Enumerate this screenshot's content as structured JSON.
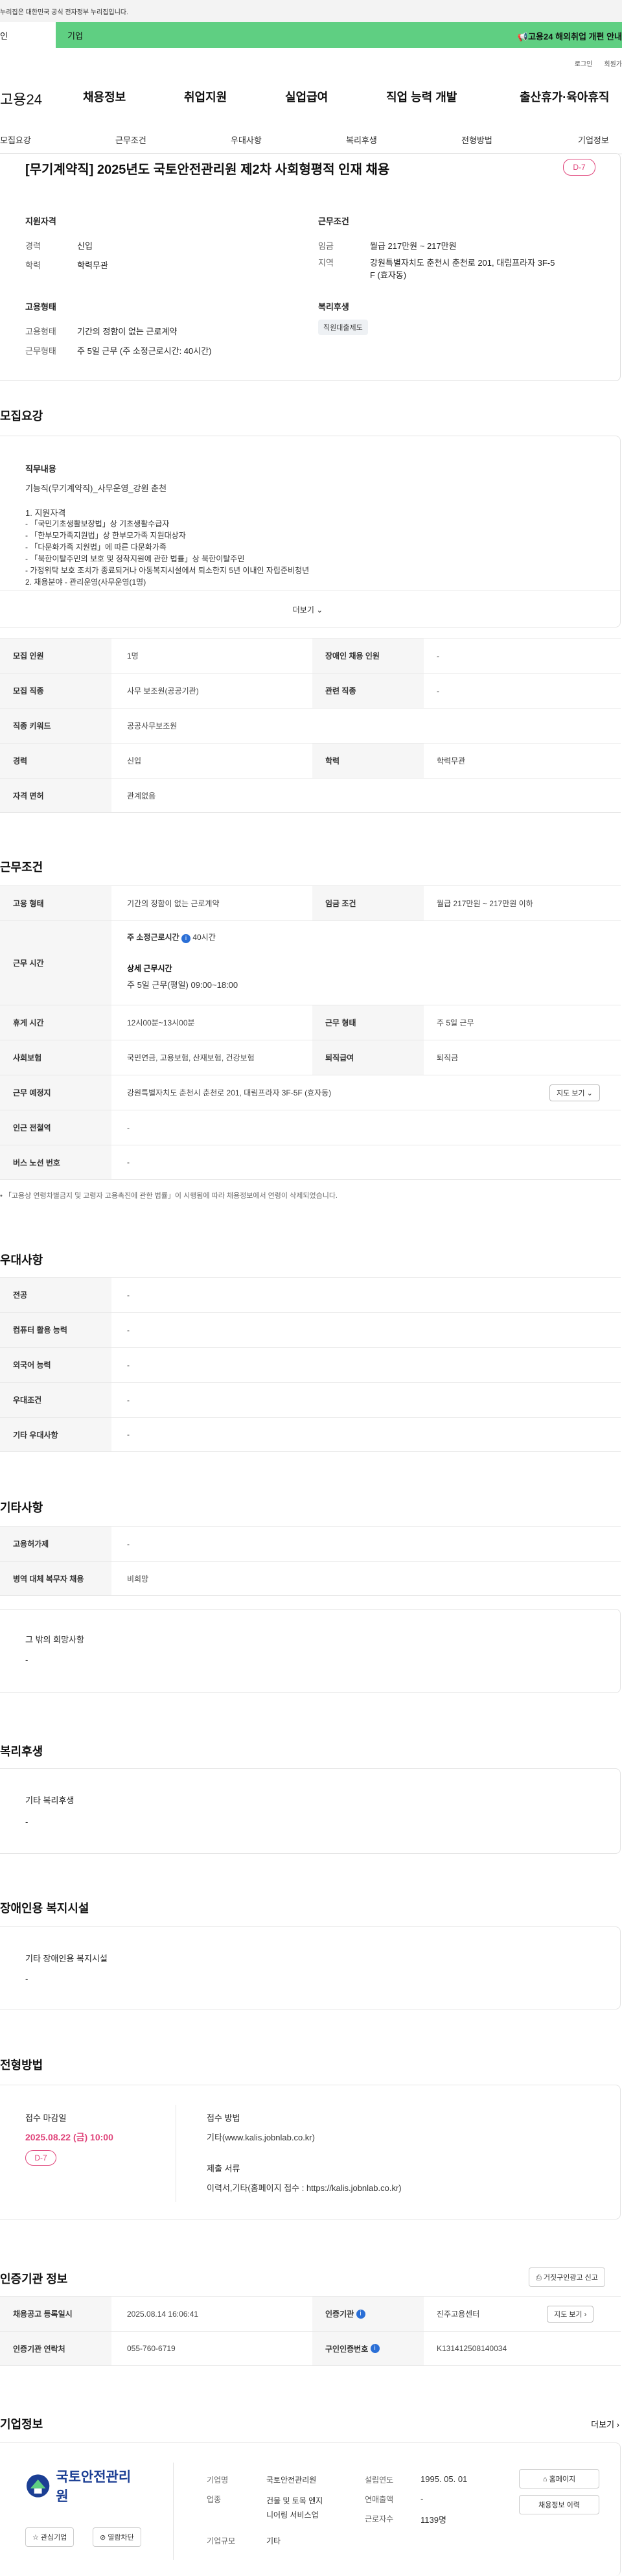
{
  "gov_notice": "누리집은 대한민국 공식 전자정부 누리집입니다.",
  "category": {
    "left": "인",
    "main": "기업",
    "banner": "고용24 해외취업 개편 안내"
  },
  "util": [
    "로그인",
    "회원가"
  ],
  "gnb": {
    "logo": "고용24",
    "items": [
      "채용정보",
      "취업지원",
      "실업급여",
      "직업 능력 개발",
      "출산휴가·육아휴직"
    ]
  },
  "subnav": [
    "모집요강",
    "근무조건",
    "우대사항",
    "복리후생",
    "전형방법",
    "기업정보"
  ],
  "header_card": {
    "title": "[무기계약직] 2025년도 국토안전관리원 제2차 사회형평적 인재 채용",
    "dday": "D-7",
    "qual_heading": "지원자격",
    "career_label": "경력",
    "career_value": "신입",
    "edu_label": "학력",
    "edu_value": "학력무관",
    "work_heading": "근무조건",
    "wage_label": "임금",
    "wage_value": "월급 217만원 ~ 217만원",
    "region_label": "지역",
    "region_value_1": "강원특별자치도 춘천시 춘천로 201, 대림프라자 3F-5",
    "region_value_2": "F (효자동)",
    "emp_heading": "고용형태",
    "emp_type_label": "고용형태",
    "emp_type_value": "기간의 정함이 없는 근로계약",
    "work_form_label": "근무형태",
    "work_form_value": "주 5일 근무 (주 소정근로시간: 40시간)",
    "welfare_heading": "복리후생",
    "welfare_badge": "직원대출제도"
  },
  "recruit": {
    "title": "모집요강",
    "job_heading": "직무내용",
    "job_line1": "기능직(무기계약직)_사무운영_강원 춘천",
    "lines": [
      "1. 지원자격",
      "  - 「국민기초생활보장법」상 기초생활수급자",
      "  - 「한부모가족지원법」상 한부모가족 지원대상자",
      "  - 「다문화가족 지원법」에 따른 다문화가족",
      "  - 「북한이탈주민의 보호 및 정착지원에 관한 법률」상 북한이탈주민",
      "  - 가정위탁 보호 조치가 종료되거나 아동복지시설에서 퇴소한지 5년 이내인 자립준비청년",
      "2. 채용분야 - 관리운영(사무운영(1명)"
    ],
    "more": "더보기",
    "rows": [
      {
        "k1": "모집 인원",
        "v1": "1명",
        "k2": "장애인 채용 인원",
        "v2": "-"
      },
      {
        "k1": "모집 직종",
        "v1": "사무 보조원(공공기관)",
        "k2": "관련 직종",
        "v2": "-"
      },
      {
        "k1": "직종 키워드",
        "v1": "공공사무보조원",
        "k2": "",
        "v2": ""
      },
      {
        "k1": "경력",
        "v1": "신입",
        "k2": "학력",
        "v2": "학력무관"
      },
      {
        "k1": "자격 면허",
        "v1": "관계없음",
        "k2": "",
        "v2": ""
      }
    ]
  },
  "work": {
    "title": "근무조건",
    "emp_label": "고용 형태",
    "emp_value": "기간의 정함이 없는 근로계약",
    "wage_label": "임금 조건",
    "wage_value": "월급 217만원 ~ 217만원 이하",
    "hours_label": "근무 시간",
    "hours_main": "주 소정근로시간",
    "hours_num": "40시간",
    "hours_detail_h": "상세 근무시간",
    "hours_detail": "주 5일 근무(평일) 09:00~18:00",
    "rest_label": "휴게 시간",
    "rest_value": "12시00분~13시00분",
    "form_label": "근무 형태",
    "form_value": "주 5일 근무",
    "ins_label": "사회보험",
    "ins_value": "국민연금, 고용보험, 산재보험, 건강보험",
    "retire_label": "퇴직급여",
    "retire_value": "퇴직금",
    "place_label": "근무 예정지",
    "place_value": "강원특별자치도 춘천시 춘천로 201, 대림프라자 3F-5F (효자동)",
    "map_btn": "지도 보기",
    "subway_label": "인근 전철역",
    "subway_value": "-",
    "bus_label": "버스 노선 번호",
    "bus_value": "-",
    "note": "「고용상 연령차별금지 및 고령자 고용촉진에 관한 법률」이 시행됨에 따라 채용정보에서 연령이 삭제되었습니다."
  },
  "pref": {
    "title": "우대사항",
    "rows": [
      [
        "전공",
        "-"
      ],
      [
        "컴퓨터 활용 능력",
        "-"
      ],
      [
        "외국어 능력",
        "-"
      ],
      [
        "우대조건",
        "-"
      ],
      [
        "기타 우대사항",
        "-"
      ]
    ]
  },
  "etc": {
    "title": "기타사항",
    "rows": [
      [
        "고용허가제",
        "-"
      ],
      [
        "병역 대체 복무자 채용",
        "비희망"
      ]
    ],
    "other_h": "그 밖의 희망사항",
    "other_v": "-"
  },
  "welfare": {
    "title": "복리후생",
    "h": "기타 복리후생",
    "v": "-"
  },
  "disabled": {
    "title": "장애인용 복지시설",
    "h": "기타 장애인용 복지시설",
    "v": "-"
  },
  "process": {
    "title": "전형방법",
    "deadline_h": "접수 마감일",
    "deadline": "2025.08.22 (금) 10:00",
    "dday": "D-7",
    "method_h": "접수 방법",
    "method": "기타(www.kalis.jobnlab.co.kr)",
    "docs_h": "제출 서류",
    "docs": "이력서,기타(홈페이지 접수 : https://kalis.jobnlab.co.kr)"
  },
  "cert": {
    "title": "인증기관 정보",
    "btn": "거짓구인광고 신고",
    "reg_label": "채용공고 등록일시",
    "reg_value": "2025.08.14 16:06:41",
    "org_label": "인증기관",
    "org_value": "진주고용센터",
    "map_btn": "지도 보기",
    "contact_label": "인증기관 연락처",
    "contact_value": "055-760-6719",
    "id_label": "구인인증번호",
    "id_value": "K131412508140034"
  },
  "company": {
    "title": "기업정보",
    "more": "더보기",
    "logo_text": "국토안전관리원",
    "follow": "관심기업",
    "block": "열람차단",
    "name_label": "기업명",
    "name_value": "국토안전관리원",
    "industry_label": "업종",
    "industry_value_1": "건물 및 토목 엔지",
    "industry_value_2": "니어링 서비스업",
    "size_label": "기업규모",
    "size_value": "기타",
    "found_label": "설립연도",
    "found_value": "1995. 05. 01",
    "sales_label": "연매출액",
    "sales_value": "-",
    "emp_label": "근로자수",
    "emp_value": "1139명",
    "home_btn": "홈페이지",
    "history_btn": "채용정보 이력"
  },
  "colors": {
    "green": "#5fcf82",
    "accent_red": "#e0457b",
    "info_blue": "#2b6fd6",
    "logo_blue": "#1c3f94"
  }
}
